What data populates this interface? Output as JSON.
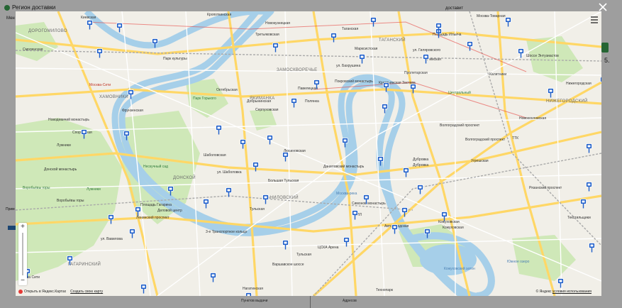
{
  "background_page": {
    "header_title": "Регион доставки",
    "left_label": "Мен",
    "right_label": "доставит",
    "right_number": "5.",
    "left_text": "Прим",
    "bottom_a": "Пунктов выдачи",
    "bottom_b": "Адресов"
  },
  "map": {
    "districts": [
      {
        "text": "ДОРОГОМИЛОВО"
      },
      {
        "text": "ХАМОВНИКИ"
      },
      {
        "text": "ЯКИМАНКА"
      },
      {
        "text": "ЗАМОСКВОРЕЧЬЕ"
      },
      {
        "text": "ТАГАНСКИЙ"
      },
      {
        "text": "ДОНСКОЙ"
      },
      {
        "text": "ДАНИЛОВСКИЙ"
      },
      {
        "text": "НИЖЕГОРОДСКИЙ"
      },
      {
        "text": "ГАГАРИНСКИЙ"
      }
    ],
    "stations": [
      {
        "text": "Киевская"
      },
      {
        "text": "Смоленская"
      },
      {
        "text": "Кропоткинская"
      },
      {
        "text": "Парк культуры"
      },
      {
        "text": "Фрунзенская"
      },
      {
        "text": "Спортивная"
      },
      {
        "text": "Шаболовская"
      },
      {
        "text": "Ленинский проспект"
      },
      {
        "text": "Октябрьская"
      },
      {
        "text": "Добрынинская"
      },
      {
        "text": "Серпуховская"
      },
      {
        "text": "Павелецкая"
      },
      {
        "text": "Третьяковская"
      },
      {
        "text": "Новокузнецкая"
      },
      {
        "text": "Таганская"
      },
      {
        "text": "Марксистская"
      },
      {
        "text": "Пролетарская"
      },
      {
        "text": "Дубровка"
      },
      {
        "text": "Кожуховская"
      },
      {
        "text": "Автозаводская"
      },
      {
        "text": "Тульская"
      },
      {
        "text": "Нагатинская"
      },
      {
        "text": "Тульская"
      },
      {
        "text": "Текстильщики"
      },
      {
        "text": "Нижегородская"
      },
      {
        "text": "Новохохловская"
      },
      {
        "text": "Угрешская"
      },
      {
        "text": "Волгоградский проспект"
      },
      {
        "text": "Крестьянская Застава"
      },
      {
        "text": "Римская"
      },
      {
        "text": "Площадь Ильича"
      },
      {
        "text": "Калитники"
      },
      {
        "text": "Москва-Товарная"
      },
      {
        "text": "Лужники"
      },
      {
        "text": "Воробьёвы горы"
      },
      {
        "text": "Площадь Гагарина"
      },
      {
        "text": "Москва Сити"
      },
      {
        "text": "Полянка"
      },
      {
        "text": "Деловой центр"
      },
      {
        "text": "ЗИЛ"
      },
      {
        "text": "Технопарк"
      },
      {
        "text": "Кожуховская"
      },
      {
        "text": "Дубровка"
      }
    ],
    "places": [
      {
        "text": "Нескучный сад"
      },
      {
        "text": "Новодевичий монастырь"
      },
      {
        "text": "Донской монастырь"
      },
      {
        "text": "Даниловский монастырь"
      },
      {
        "text": "Симонов монастырь"
      },
      {
        "text": "Центральный"
      },
      {
        "text": "Покровский монастырь"
      },
      {
        "text": "Москва-Сити"
      },
      {
        "text": "ЦСКА Арена"
      },
      {
        "text": "Южное озеро"
      },
      {
        "text": "Кожуховский затон"
      },
      {
        "text": "Лужники"
      },
      {
        "text": "Парк Горького"
      },
      {
        "text": "Воробьёвы горы"
      }
    ],
    "streets": [
      {
        "text": "ул. Шаболовка"
      },
      {
        "text": "3-е Транспортное кольцо"
      },
      {
        "text": "Люсиновская"
      },
      {
        "text": "ул. Бахрушина"
      },
      {
        "text": "Большая Тульская"
      },
      {
        "text": "Варшавское шоссе"
      },
      {
        "text": "ТТК"
      },
      {
        "text": "ул. Гиляровского"
      },
      {
        "text": "ул. Вавилова"
      },
      {
        "text": "Рязанский проспект"
      },
      {
        "text": "Волгоградский проспект"
      },
      {
        "text": "Шоссе Энтузиастов"
      }
    ],
    "river_labels": [
      {
        "text": "Москва-река"
      }
    ],
    "zoom": {
      "in": "+",
      "out": "−"
    },
    "attribution": {
      "open_in": "Открыть в Яндекс.Картах",
      "create": "Создать свою карту",
      "copyright": "© Яндекс",
      "terms": "условия использования"
    }
  },
  "colors": {
    "park": "#cfe8b8",
    "water": "#a6cfe9",
    "road_major": "#ffd766",
    "road_minor": "#ffffff",
    "rail": "#a9a9a9",
    "metro_red": "#e53935",
    "pin": "#1e5ec9"
  }
}
